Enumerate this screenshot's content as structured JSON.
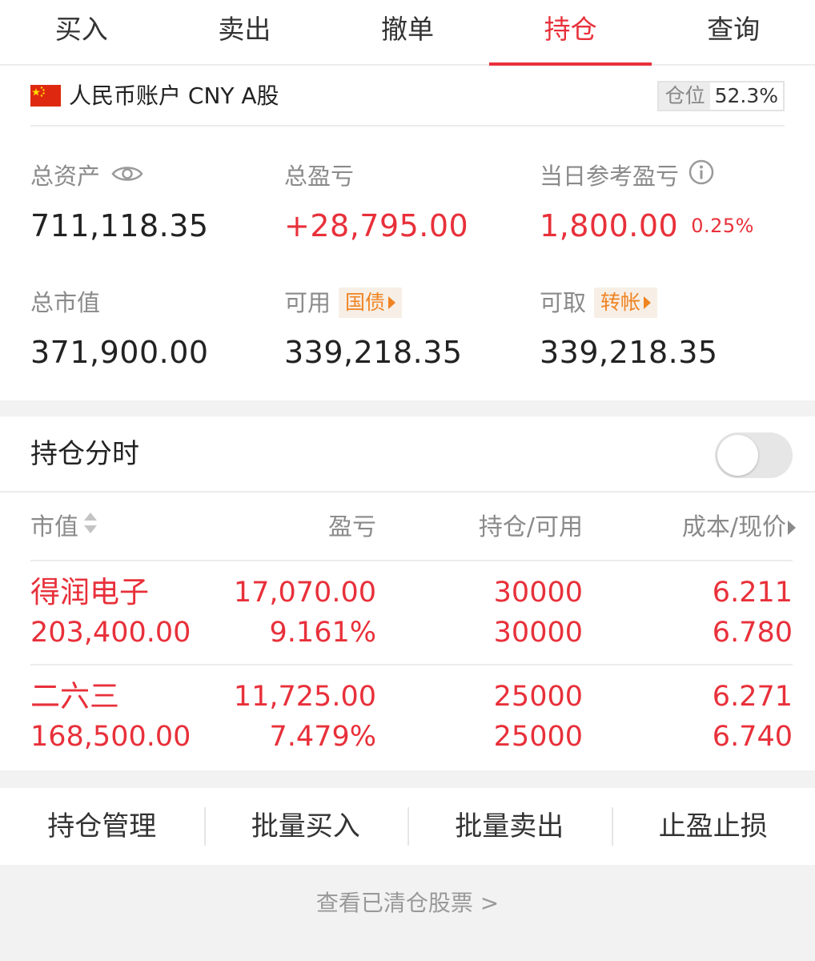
{
  "tabs": [
    {
      "label": "买入"
    },
    {
      "label": "卖出"
    },
    {
      "label": "撤单"
    },
    {
      "label": "持仓",
      "active": true
    },
    {
      "label": "查询"
    }
  ],
  "account": {
    "name": "人民币账户 CNY A股",
    "position_label": "仓位",
    "position_value": "52.3%"
  },
  "summary": {
    "total_assets": {
      "label": "总资产",
      "value": "711,118.35"
    },
    "total_pnl": {
      "label": "总盈亏",
      "value": "+28,795.00"
    },
    "today_pnl": {
      "label": "当日参考盈亏",
      "value": "1,800.00",
      "percent": "0.25%"
    },
    "market_value": {
      "label": "总市值",
      "value": "371,900.00"
    },
    "available": {
      "label": "可用",
      "chip": "国债",
      "value": "339,218.35"
    },
    "withdrawable": {
      "label": "可取",
      "chip": "转帐",
      "value": "339,218.35"
    }
  },
  "timeshare": {
    "label": "持仓分时",
    "enabled": false
  },
  "table": {
    "headers": [
      "市值",
      "盈亏",
      "持仓/可用",
      "成本/现价"
    ],
    "rows": [
      {
        "name": "得润电子",
        "market_value": "203,400.00",
        "pnl": "17,070.00",
        "pnl_pct": "9.161%",
        "holding": "30000",
        "available": "30000",
        "cost": "6.211",
        "price": "6.780"
      },
      {
        "name": "二六三",
        "market_value": "168,500.00",
        "pnl": "11,725.00",
        "pnl_pct": "7.479%",
        "holding": "25000",
        "available": "25000",
        "cost": "6.271",
        "price": "6.740"
      }
    ]
  },
  "actions": [
    {
      "label": "持仓管理"
    },
    {
      "label": "批量买入"
    },
    {
      "label": "批量卖出"
    },
    {
      "label": "止盈止损"
    }
  ],
  "footer": {
    "cleared_link": "查看已清仓股票 >"
  },
  "colors": {
    "accent_red": "#e8303a",
    "chip_orange": "#f08322",
    "muted_gray": "#8a8a8a"
  },
  "icons": {
    "flag": "china-flag-icon",
    "eye": "eye-icon",
    "info": "info-icon",
    "sort": "sort-icon",
    "chevron": "chevron-right-icon"
  }
}
